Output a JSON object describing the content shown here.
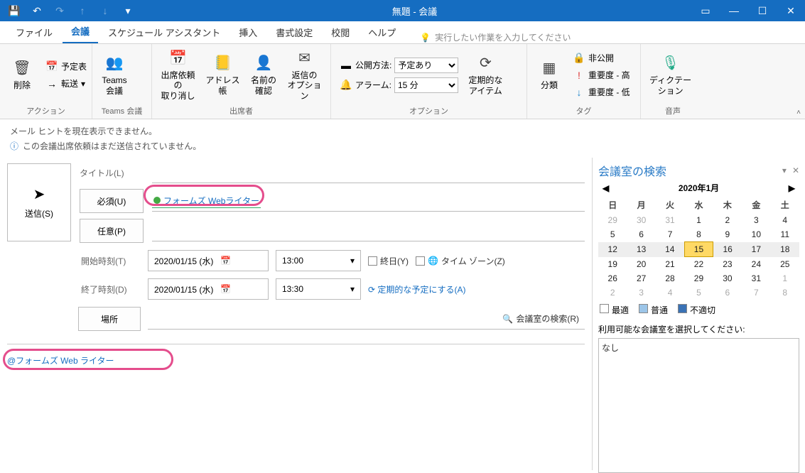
{
  "titlebar": {
    "title": "無題 - 会議"
  },
  "tabs": {
    "file": "ファイル",
    "meeting": "会議",
    "schedule": "スケジュール アシスタント",
    "insert": "挿入",
    "format": "書式設定",
    "review": "校閲",
    "help": "ヘルプ",
    "tellme": "実行したい作業を入力してください"
  },
  "ribbon": {
    "actions": {
      "label": "アクション",
      "delete": "削除",
      "calendar": "予定表",
      "forward": "転送"
    },
    "teams": {
      "label": "Teams 会議",
      "btn": "Teams\n会議"
    },
    "attendees": {
      "label": "出席者",
      "cancel": "出席依頼の\n取り消し",
      "address": "アドレス帳",
      "names": "名前の\n確認",
      "response": "返信の\nオプション"
    },
    "options": {
      "label": "オプション",
      "showas": "公開方法:",
      "showas_val": "予定あり",
      "reminder": "アラーム:",
      "reminder_val": "15 分",
      "recur": "定期的な\nアイテム"
    },
    "tags": {
      "label": "タグ",
      "categorize": "分類",
      "private": "非公開",
      "high": "重要度 - 高",
      "low": "重要度 - 低"
    },
    "voice": {
      "label": "音声",
      "dictate": "ディクテー\nション"
    }
  },
  "info": {
    "tip": "メール ヒントを現在表示できません。",
    "notsent": "この会議出席依頼はまだ送信されていません。"
  },
  "form": {
    "send": "送信(S)",
    "title": "タイトル(L)",
    "required": "必須(U)",
    "optional": "任意(P)",
    "attendee": "フォームズ Webライター",
    "start": "開始時刻(T)",
    "end": "終了時刻(D)",
    "start_date": "2020/01/15 (水)",
    "start_time": "13:00",
    "end_date": "2020/01/15 (水)",
    "end_time": "13:30",
    "allday": "終日(Y)",
    "timezone": "タイム ゾーン(Z)",
    "make_recurring": "定期的な予定にする(A)",
    "location": "場所",
    "room_search": "会議室の検索(R)",
    "mention": "@フォームズ Web ライター"
  },
  "side": {
    "title": "会議室の検索",
    "month": "2020年1月",
    "dow": [
      "日",
      "月",
      "火",
      "水",
      "木",
      "金",
      "土"
    ],
    "weeks": [
      [
        {
          "d": 29,
          "o": 1
        },
        {
          "d": 30,
          "o": 1
        },
        {
          "d": 31,
          "o": 1
        },
        {
          "d": 1
        },
        {
          "d": 2
        },
        {
          "d": 3
        },
        {
          "d": 4
        }
      ],
      [
        {
          "d": 5
        },
        {
          "d": 6
        },
        {
          "d": 7
        },
        {
          "d": 8
        },
        {
          "d": 9
        },
        {
          "d": 10
        },
        {
          "d": 11
        }
      ],
      [
        {
          "d": 12
        },
        {
          "d": 13
        },
        {
          "d": 14
        },
        {
          "d": 15,
          "s": 1
        },
        {
          "d": 16
        },
        {
          "d": 17
        },
        {
          "d": 18
        }
      ],
      [
        {
          "d": 19
        },
        {
          "d": 20
        },
        {
          "d": 21
        },
        {
          "d": 22
        },
        {
          "d": 23
        },
        {
          "d": 24
        },
        {
          "d": 25
        }
      ],
      [
        {
          "d": 26
        },
        {
          "d": 27
        },
        {
          "d": 28
        },
        {
          "d": 29
        },
        {
          "d": 30
        },
        {
          "d": 31
        },
        {
          "d": 1,
          "o": 1
        }
      ],
      [
        {
          "d": 2,
          "o": 1
        },
        {
          "d": 3,
          "o": 1
        },
        {
          "d": 4,
          "o": 1
        },
        {
          "d": 5,
          "o": 1
        },
        {
          "d": 6,
          "o": 1
        },
        {
          "d": 7,
          "o": 1
        },
        {
          "d": 8,
          "o": 1
        }
      ]
    ],
    "legend": {
      "good": "最適",
      "fair": "普通",
      "poor": "不適切"
    },
    "room_prompt": "利用可能な会議室を選択してください:",
    "none": "なし"
  }
}
